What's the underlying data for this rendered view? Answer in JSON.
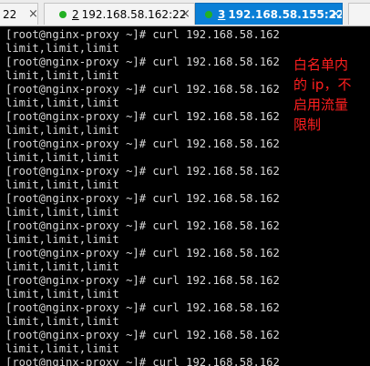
{
  "tabs": [
    {
      "label": "22",
      "dot": false,
      "active": false
    },
    {
      "number": "2",
      "label": "192.168.58.162:22",
      "dot": true,
      "active": false
    },
    {
      "number": "3",
      "label": "192.168.58.155:22",
      "dot": true,
      "active": true
    },
    {
      "label": "",
      "dot": false,
      "active": false
    }
  ],
  "close_glyph": "×",
  "colors": {
    "active_tab": "#0a7fd6",
    "status_dot": "#23b123",
    "terminal_bg": "#000000",
    "terminal_fg": "#d8d8d8",
    "annotation": "#ff1f1f"
  },
  "terminal": {
    "lines": [
      "[root@nginx-proxy ~]# curl 192.168.58.162",
      "limit,limit,limit",
      "[root@nginx-proxy ~]# curl 192.168.58.162",
      "limit,limit,limit",
      "[root@nginx-proxy ~]# curl 192.168.58.162",
      "limit,limit,limit",
      "[root@nginx-proxy ~]# curl 192.168.58.162",
      "limit,limit,limit",
      "[root@nginx-proxy ~]# curl 192.168.58.162",
      "limit,limit,limit",
      "[root@nginx-proxy ~]# curl 192.168.58.162",
      "limit,limit,limit",
      "[root@nginx-proxy ~]# curl 192.168.58.162",
      "limit,limit,limit",
      "[root@nginx-proxy ~]# curl 192.168.58.162",
      "limit,limit,limit",
      "[root@nginx-proxy ~]# curl 192.168.58.162",
      "limit,limit,limit",
      "[root@nginx-proxy ~]# curl 192.168.58.162",
      "limit,limit,limit",
      "[root@nginx-proxy ~]# curl 192.168.58.162",
      "limit,limit,limit",
      "[root@nginx-proxy ~]# curl 192.168.58.162",
      "limit,limit,limit",
      "[root@nginx-proxy ~]# curl 192.168.58.162"
    ]
  },
  "annotation": {
    "lines": [
      "白名单内",
      "的 ip，不",
      "启用流量",
      "限制"
    ]
  }
}
